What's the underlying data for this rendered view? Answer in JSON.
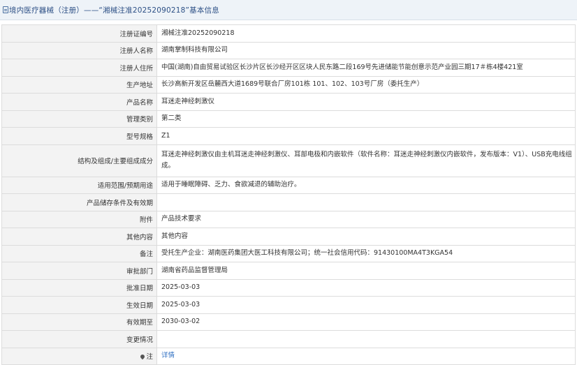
{
  "header": {
    "title": "境内医疗器械（注册）——“湘械注准20252090218”基本信息",
    "icon": "document-icon"
  },
  "rows": [
    {
      "label": "注册证编号",
      "value": "湘械注准20252090218"
    },
    {
      "label": "注册人名称",
      "value": "湖南掌制科技有限公司"
    },
    {
      "label": "注册人住所",
      "value": "中国(湖南)自由贸易试验区长沙片区长沙经开区区块人民东路二段169号先进储能节能创意示范产业园三期17＃栋4楼421室"
    },
    {
      "label": "生产地址",
      "value": "长沙高新开发区岳麓西大道1689号联合厂房101栋 101、102、103号厂房（委托生产）"
    },
    {
      "label": "产品名称",
      "value": "耳迷走神经刺激仪"
    },
    {
      "label": "管理类别",
      "value": "第二类"
    },
    {
      "label": "型号规格",
      "value": "Z1"
    },
    {
      "label": "结构及组成/主要组成成分",
      "value": "耳迷走神经刺激仪由主机耳迷走神经刺激仪、耳部电极和内嵌软件（软件名称：耳迷走神经刺激仪内嵌软件，发布版本：V1）、USB充电线组成。"
    },
    {
      "label": "适用范围/预期用途",
      "value": "适用于睡眠障碍、乏力、食欲减退的辅助治疗。"
    },
    {
      "label": "产品储存条件及有效期",
      "value": ""
    },
    {
      "label": "附件",
      "value": "产品技术要求"
    },
    {
      "label": "其他内容",
      "value": "其他内容"
    },
    {
      "label": "备注",
      "value": "受托生产企业：湖南医药集团大医工科技有限公司；统一社会信用代码：91430100MA4T3KGA54"
    },
    {
      "label": "审批部门",
      "value": "湖南省药品监督管理局"
    },
    {
      "label": "批准日期",
      "value": "2025-03-03"
    },
    {
      "label": "生效日期",
      "value": "2025-03-03"
    },
    {
      "label": "有效期至",
      "value": "2030-03-02"
    },
    {
      "label": "变更情况",
      "value": ""
    }
  ],
  "note_row": {
    "label": "注",
    "icon": "pin-icon",
    "link_text": "详情"
  }
}
